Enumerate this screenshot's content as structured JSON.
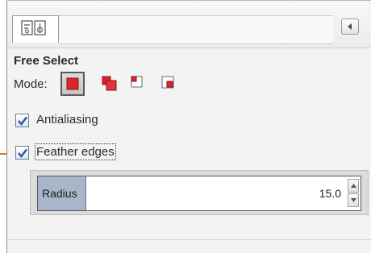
{
  "tool_title": "Free Select",
  "mode": {
    "label": "Mode:",
    "options": [
      {
        "icon": "replace-selection-icon",
        "active": true
      },
      {
        "icon": "add-to-selection-icon",
        "active": false
      },
      {
        "icon": "subtract-from-selection-icon",
        "active": false
      },
      {
        "icon": "intersect-selection-icon",
        "active": false
      }
    ]
  },
  "options": {
    "antialiasing": {
      "label": "Antialiasing",
      "checked": true
    },
    "feather_edges": {
      "label": "Feather edges",
      "checked": true
    }
  },
  "radius": {
    "label": "Radius",
    "value": "15.0",
    "fill_fraction": 0.15
  },
  "tabs": {
    "icon": "tool-options-icon",
    "menu_icon": "tab-menu-arrow-icon"
  },
  "colors": {
    "accent_red": "#d8262a",
    "checkmark_blue": "#2b4fa8",
    "slider_fill": "#a7b6c8",
    "marker_orange": "#e07a18"
  }
}
